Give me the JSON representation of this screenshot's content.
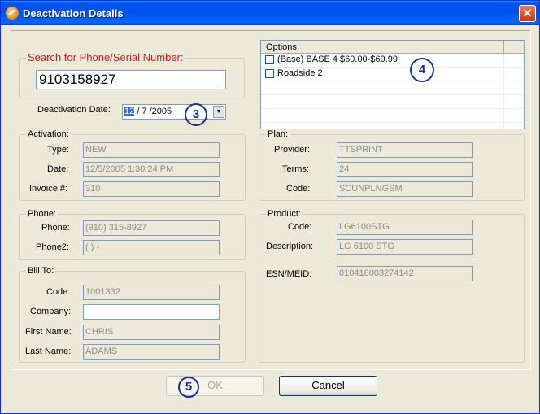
{
  "window": {
    "title": "Deactivation Details",
    "close_glyph": "✕"
  },
  "search": {
    "legend": "Search for Phone/Serial Number:",
    "value": "9103158927"
  },
  "deactivation": {
    "label": "Deactivation Date:",
    "month": "12",
    "rest": "/ 7 /2005",
    "dropdown_glyph": "▼"
  },
  "annotations": {
    "c3": "3",
    "c4": "4",
    "c5": "5"
  },
  "options": {
    "header": "Options",
    "items": [
      {
        "label": "(Base) BASE 4 $60.00-$69.99",
        "checked": false
      },
      {
        "label": "Roadside 2",
        "checked": false
      }
    ]
  },
  "activation": {
    "legend": "Activation:",
    "type_label": "Type:",
    "type": "NEW",
    "date_label": "Date:",
    "date": "12/5/2005 1:30:24 PM",
    "invoice_label": "Invoice #:",
    "invoice": "310"
  },
  "plan": {
    "legend": "Plan:",
    "provider_label": "Provider:",
    "provider": "TTSPRINT",
    "terms_label": "Terms:",
    "terms": "24",
    "code_label": "Code:",
    "code": "SCUNPLNGSM"
  },
  "phone": {
    "legend": "Phone:",
    "phone_label": "Phone:",
    "phone": "(910) 315-8927",
    "phone2_label": "Phone2:",
    "phone2": "(   )     -"
  },
  "product": {
    "legend": "Product:",
    "code_label": "Code:",
    "code": "LG6100STG",
    "desc_label": "Description:",
    "desc": "LG 6100 STG",
    "esn_label": "ESN/MEID:",
    "esn": "010418003274142"
  },
  "billto": {
    "legend": "Bill To:",
    "code_label": "Code:",
    "code": "1001332",
    "company_label": "Company:",
    "company": "",
    "first_label": "First Name:",
    "first": "CHRIS",
    "last_label": "Last Name:",
    "last": "ADAMS"
  },
  "buttons": {
    "ok": "OK",
    "cancel": "Cancel"
  },
  "colors": {
    "search_legend": "#c81e1e",
    "title_bar": "#0053ee",
    "annotation": "#1f2e8e"
  }
}
